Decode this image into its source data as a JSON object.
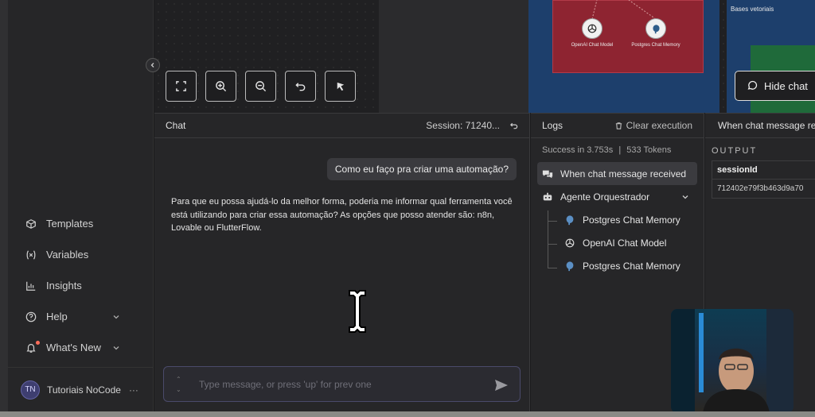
{
  "canvas": {
    "zoom_controls": [
      "fit-view-icon",
      "zoom-in-icon",
      "zoom-out-icon",
      "undo-icon",
      "cleanup-icon"
    ],
    "group_label": "Bases vetoriais",
    "nodes": [
      {
        "label": "OpenAI Chat Model",
        "icon": "openai-icon"
      },
      {
        "label": "Postgres Chat Memory",
        "icon": "postgres-icon"
      }
    ],
    "hide_chat_label": "Hide chat",
    "colors": {
      "red_frame": "#8e2431",
      "blue_frame": "#1d3f6c",
      "green_frame": "#1f6a3a"
    }
  },
  "sidebar": {
    "items": [
      {
        "label": "Templates",
        "icon": "box-icon"
      },
      {
        "label": "Variables",
        "icon": "variables-icon"
      },
      {
        "label": "Insights",
        "icon": "chart-icon"
      },
      {
        "label": "Help",
        "icon": "help-icon"
      },
      {
        "label": "What's New",
        "icon": "bell-icon"
      }
    ],
    "user": {
      "initials": "TN",
      "name": "Tutoriais NoCode",
      "more": "···"
    }
  },
  "chat": {
    "title": "Chat",
    "session": "Session: 71240...",
    "user_message": "Como eu faço pra criar uma automação?",
    "bot_message": "Para que eu possa ajudá-lo da melhor forma, poderia me informar qual ferramenta você está utilizando para criar essa automação? As opções que posso atender são: n8n, Lovable ou FlutterFlow.",
    "input_placeholder": "Type message, or press 'up' for prev one",
    "arrows_up": "⌃",
    "arrows_down": "⌄"
  },
  "logs": {
    "title": "Logs",
    "clear_label": "Clear execution",
    "summary_status": "Success in 3.753s",
    "summary_sep": "|",
    "summary_tokens": "533 Tokens",
    "entries": [
      {
        "label": "When chat message received",
        "icon": "chat-icon",
        "selected": true
      },
      {
        "label": "Agente Orquestrador",
        "icon": "robot-icon"
      },
      {
        "label": "Postgres Chat Memory",
        "icon": "postgres-icon"
      },
      {
        "label": "OpenAI Chat Model",
        "icon": "openai-icon"
      },
      {
        "label": "Postgres Chat Memory",
        "icon": "postgres-icon"
      }
    ]
  },
  "output": {
    "node_title": "When chat message received",
    "section_label": "OUTPUT",
    "column": "sessionId",
    "value": "712402e79f3b463d9a70"
  }
}
